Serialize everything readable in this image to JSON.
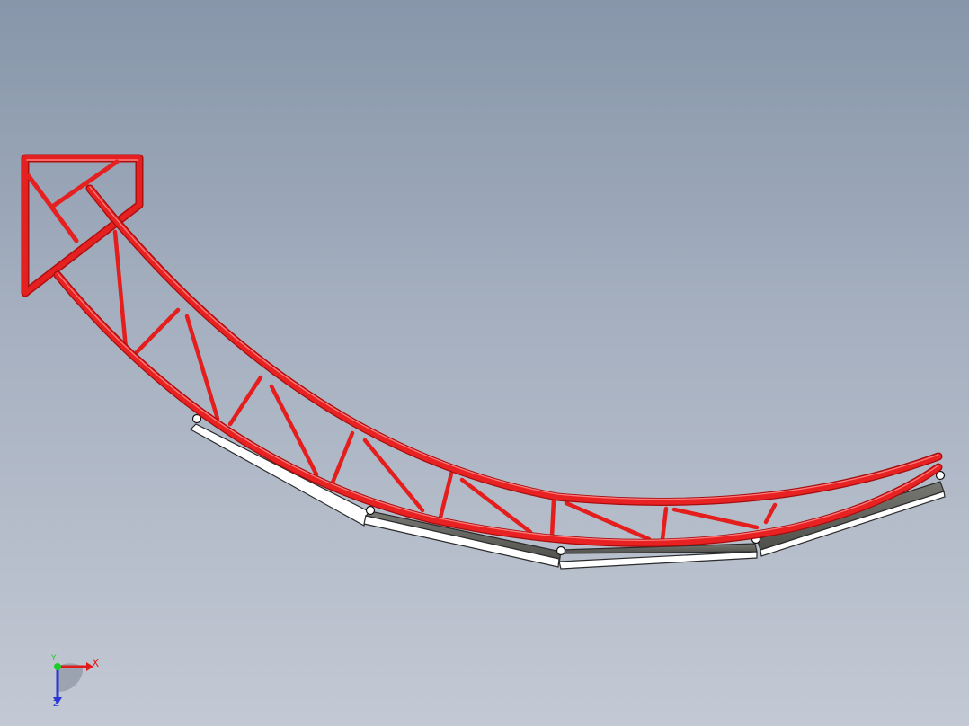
{
  "viewport": {
    "background_top": "#8796aa",
    "background_bottom": "#c3c9d4"
  },
  "model": {
    "truss_color": "#e01818",
    "truss_highlight": "#ff6b6b",
    "rail_gray_color": "#5e5f5a",
    "rail_white_color": "#ffffff",
    "support_ring_color": "#ffffff"
  },
  "triad": {
    "x_label": "X",
    "y_label": "Y",
    "z_label": "Z",
    "x_color": "#e11b1b",
    "y_color": "#1dcc2a",
    "z_color": "#2a36d6",
    "icon": "coordinate-triad-icon"
  }
}
